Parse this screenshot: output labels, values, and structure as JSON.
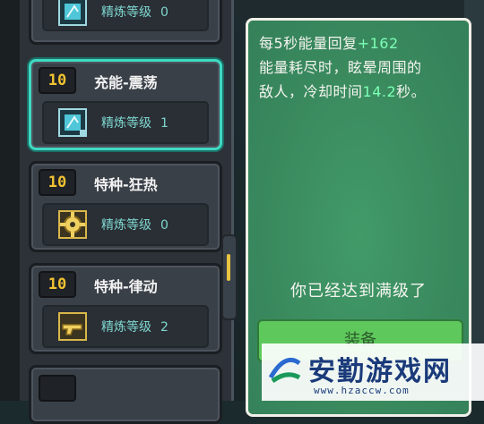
{
  "cards": [
    {
      "id": "top-partial",
      "level": "",
      "title": "",
      "refine_label": "精炼等级",
      "refine_value": "0",
      "icon": "energy-core-icon"
    },
    {
      "id": "charge-tremor",
      "level": "10",
      "title": "充能-震荡",
      "refine_label": "精炼等级",
      "refine_value": "1",
      "icon": "energy-core-icon"
    },
    {
      "id": "special-frenzy",
      "level": "10",
      "title": "特种-狂热",
      "refine_label": "精炼等级",
      "refine_value": "0",
      "icon": "gold-gear-icon"
    },
    {
      "id": "special-vibrate",
      "level": "10",
      "title": "特种-律动",
      "refine_label": "精炼等级",
      "refine_value": "2",
      "icon": "gold-gun-icon"
    }
  ],
  "detail": {
    "line1_a": "每5秒能量回复",
    "line1_b": "+162",
    "line2": "能量耗尽时，眩晕周围的",
    "line3_a": "敌人，冷却时间",
    "line3_b": "14.2",
    "line3_c": "秒。",
    "maxed_text": "你已经达到满级了",
    "equip_label": "装备"
  },
  "watermark": {
    "title": "安勤游戏网",
    "url": "www.hzaccw.com"
  },
  "colors": {
    "accent_teal": "#3fd9c2",
    "level_gold": "#f1c232",
    "highlight_green": "#7dffb6",
    "panel_green": "#3a8a5e"
  }
}
